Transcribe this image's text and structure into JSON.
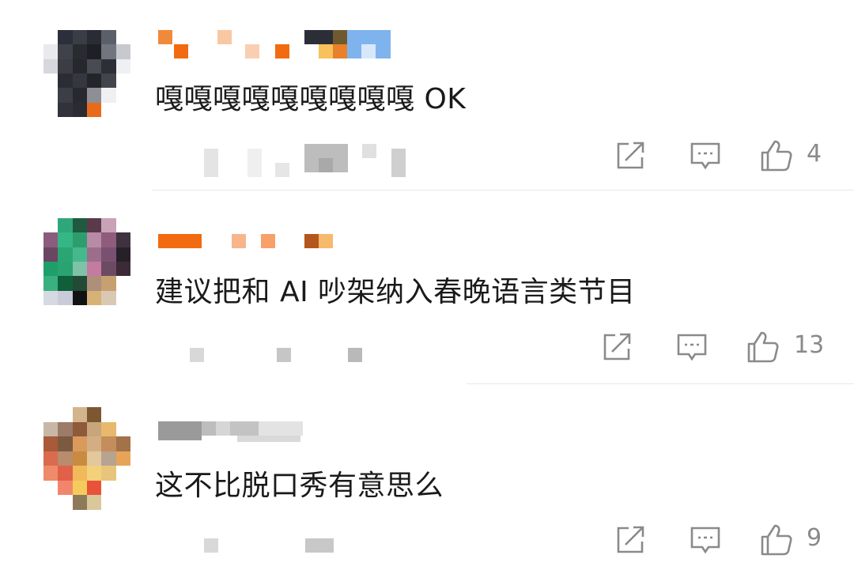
{
  "comments": [
    {
      "text": "嘎嘎嘎嘎嘎嘎嘎嘎嘎 OK",
      "likes": "4",
      "icons": [
        "share-icon",
        "reply-icon",
        "like-icon"
      ]
    },
    {
      "text": "建议把和 AI 吵架纳入春晚语言类节目",
      "likes": "13",
      "icons": [
        "share-icon",
        "reply-icon",
        "like-icon"
      ]
    },
    {
      "text": "这不比脱口秀有意思么",
      "likes": "9",
      "icons": [
        "share-icon",
        "reply-icon",
        "like-icon"
      ]
    }
  ],
  "colors": {
    "text": "#1a1a1a",
    "icon": "#8a8a8a",
    "divider": "#e8e8e8",
    "name_orange": "#f26b10"
  }
}
